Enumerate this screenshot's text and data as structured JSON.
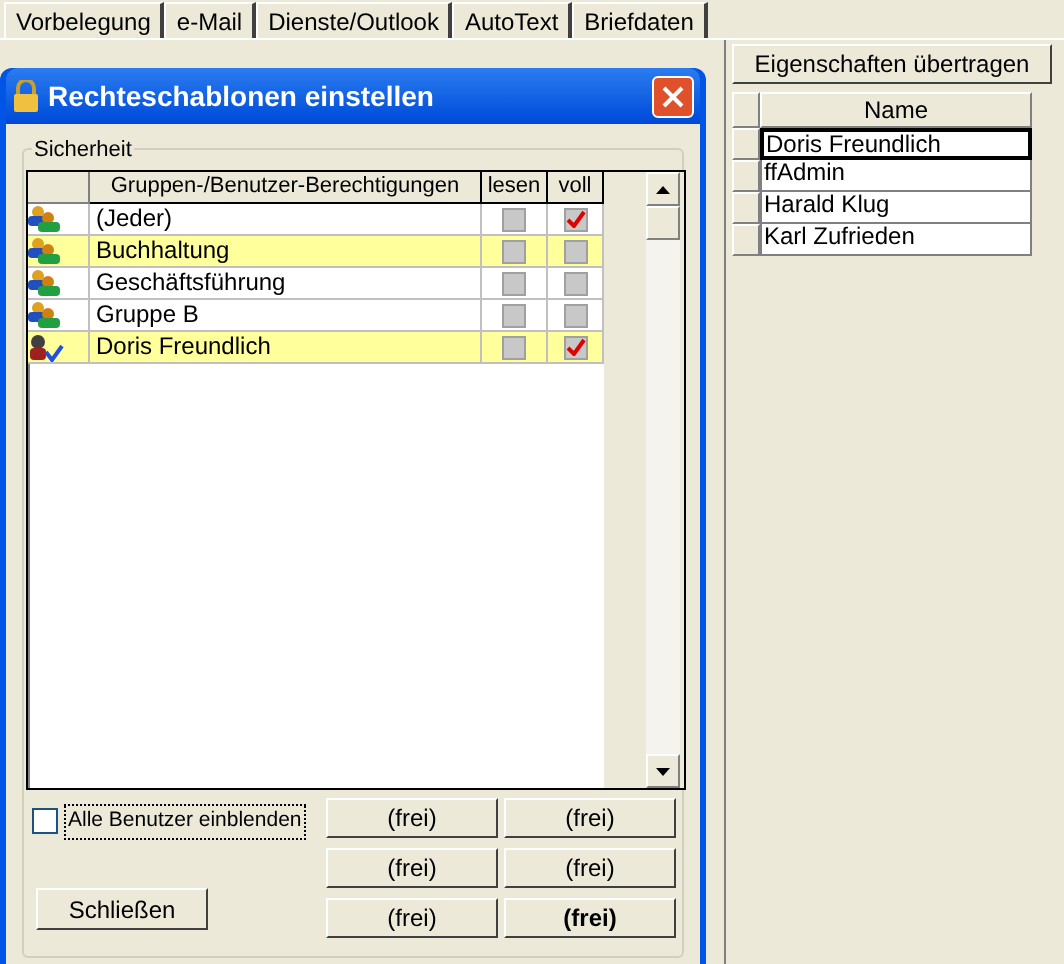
{
  "tabs": [
    {
      "label": "Vorbelegung",
      "selected": false
    },
    {
      "label": "e-Mail",
      "selected": false
    },
    {
      "label": "Dienste/Outlook",
      "selected": false
    },
    {
      "label": "AutoText",
      "selected": false
    },
    {
      "label": "Briefdaten",
      "selected": false
    }
  ],
  "transfer_button": "Eigenschaften übertragen",
  "name_table": {
    "column": "Name",
    "rows": [
      {
        "name": "Doris Freundlich",
        "selected": true
      },
      {
        "name": "ffAdmin",
        "selected": false
      },
      {
        "name": "Harald Klug",
        "selected": false
      },
      {
        "name": "Karl Zufrieden",
        "selected": false
      }
    ]
  },
  "dialog": {
    "title": "Rechteschablonen einstellen",
    "group": "Sicherheit",
    "columns": [
      "Gruppen-/Benutzer-Berechtigungen",
      "lesen",
      "voll"
    ],
    "rows": [
      {
        "kind": "group",
        "name": "(Jeder)",
        "highlighted": false,
        "lesen": false,
        "voll": true
      },
      {
        "kind": "group",
        "name": "Buchhaltung",
        "highlighted": true,
        "lesen": false,
        "voll": false
      },
      {
        "kind": "group",
        "name": "Geschäftsführung",
        "highlighted": false,
        "lesen": false,
        "voll": false
      },
      {
        "kind": "group",
        "name": "Gruppe B",
        "highlighted": false,
        "lesen": false,
        "voll": false
      },
      {
        "kind": "user",
        "name": "Doris Freundlich",
        "highlighted": true,
        "lesen": false,
        "voll": true
      }
    ],
    "show_all": {
      "label": "Alle Benutzer einblenden",
      "checked": false
    },
    "slot_buttons": [
      {
        "label": "(frei)",
        "default": false
      },
      {
        "label": "(frei)",
        "default": false
      },
      {
        "label": "(frei)",
        "default": false
      },
      {
        "label": "(frei)",
        "default": false
      },
      {
        "label": "(frei)",
        "default": false
      },
      {
        "label": "(frei)",
        "default": true
      }
    ],
    "close_button": "Schließen"
  }
}
